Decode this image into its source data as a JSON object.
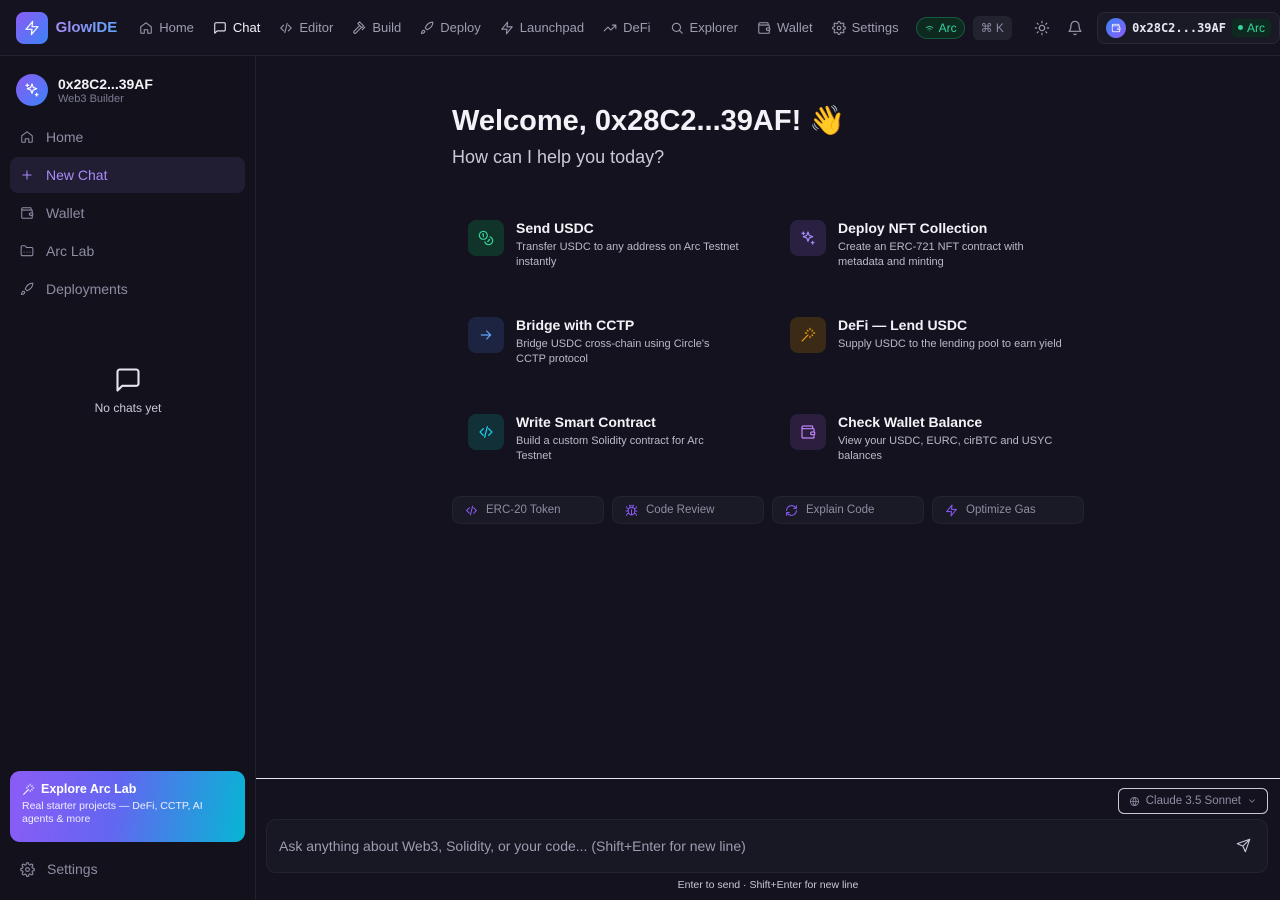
{
  "app": {
    "name": "GlowIDE"
  },
  "topnav": {
    "items": [
      {
        "label": "Home",
        "icon": "home-icon"
      },
      {
        "label": "Chat",
        "icon": "chat-icon",
        "active": true
      },
      {
        "label": "Editor",
        "icon": "code-icon"
      },
      {
        "label": "Build",
        "icon": "hammer-icon"
      },
      {
        "label": "Deploy",
        "icon": "rocket-icon"
      },
      {
        "label": "Launchpad",
        "icon": "zap-icon"
      },
      {
        "label": "DeFi",
        "icon": "trend-icon"
      },
      {
        "label": "Explorer",
        "icon": "search-icon"
      },
      {
        "label": "Wallet",
        "icon": "wallet-icon"
      },
      {
        "label": "Settings",
        "icon": "gear-icon"
      }
    ],
    "network_pill": "Arc",
    "shortcut": "⌘ K",
    "wallet": {
      "address": "0x28C2...39AF",
      "network": "Arc"
    }
  },
  "sidebar": {
    "profile": {
      "name": "0x28C2...39AF",
      "role": "Web3 Builder"
    },
    "items": [
      {
        "label": "Home"
      },
      {
        "label": "New Chat",
        "active": true
      },
      {
        "label": "Wallet"
      },
      {
        "label": "Arc Lab"
      },
      {
        "label": "Deployments"
      }
    ],
    "empty_chats": "No chats yet",
    "promo": {
      "title": "Explore Arc Lab",
      "description": "Real starter projects — DeFi, CCTP, AI agents & more"
    },
    "settings_label": "Settings"
  },
  "main": {
    "welcome": "Welcome, 0x28C2...39AF! 👋",
    "subtitle": "How can I help you today?",
    "cards": [
      {
        "title": "Send USDC",
        "desc": "Transfer USDC to any address on Arc Testnet instantly",
        "icon": "coins-icon",
        "color": "#34d399"
      },
      {
        "title": "Deploy NFT Collection",
        "desc": "Create an ERC-721 NFT contract with metadata and minting",
        "icon": "sparkles-icon",
        "color": "#a78bfa"
      },
      {
        "title": "Bridge with CCTP",
        "desc": "Bridge USDC cross-chain using Circle's CCTP protocol",
        "icon": "arrow-right-icon",
        "color": "#60a5fa"
      },
      {
        "title": "DeFi — Lend USDC",
        "desc": "Supply USDC to the lending pool to earn yield",
        "icon": "wand-icon",
        "color": "#f59e0b"
      },
      {
        "title": "Write Smart Contract",
        "desc": "Build a custom Solidity contract for Arc Testnet",
        "icon": "code-icon",
        "color": "#22d3ee"
      },
      {
        "title": "Check Wallet Balance",
        "desc": "View your USDC, EURC, cirBTC and USYC balances",
        "icon": "wallet-icon",
        "color": "#c084fc"
      }
    ],
    "chips": [
      {
        "label": "ERC-20 Token",
        "icon": "code-icon"
      },
      {
        "label": "Code Review",
        "icon": "bug-icon"
      },
      {
        "label": "Explain Code",
        "icon": "refresh-icon"
      },
      {
        "label": "Optimize Gas",
        "icon": "zap-icon"
      }
    ]
  },
  "composer": {
    "model": "Claude 3.5 Sonnet",
    "placeholder": "Ask anything about Web3, Solidity, or your code... (Shift+Enter for new line)",
    "value": "",
    "hint": "Enter to send · Shift+Enter for new line"
  },
  "colors": {
    "accent": "#8b5cf6",
    "accent_text": "#a78bfa",
    "success": "#34d399",
    "background": "#13121e"
  }
}
